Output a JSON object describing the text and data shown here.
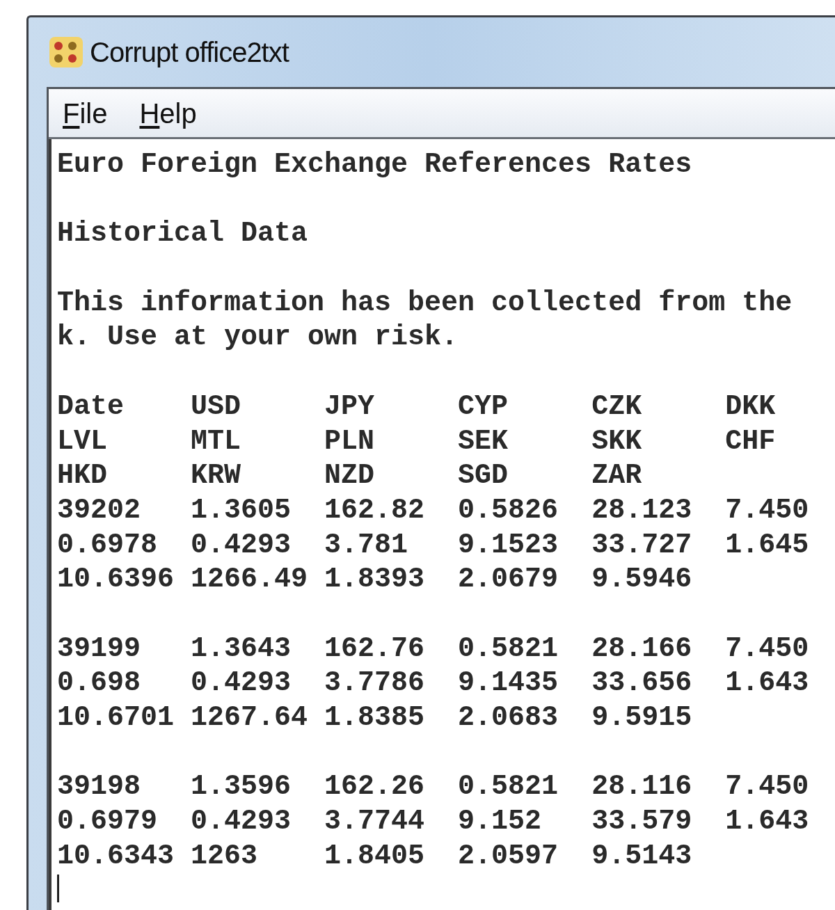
{
  "window": {
    "title": "Corrupt office2txt"
  },
  "menu": [
    {
      "label": "File",
      "underlined_first": true
    },
    {
      "label": "Help",
      "underlined_first": true
    }
  ],
  "document": {
    "blocks": [
      [
        "Euro Foreign Exchange References Rates"
      ],
      [
        "Historical Data"
      ],
      [
        "This information has been collected from the",
        "k. Use at your own risk."
      ],
      [
        "Date    USD     JPY     CYP     CZK     DKK",
        "LVL     MTL     PLN     SEK     SKK     CHF",
        "HKD     KRW     NZD     SGD     ZAR",
        "39202   1.3605  162.82  0.5826  28.123  7.450",
        "0.6978  0.4293  3.781   9.1523  33.727  1.645",
        "10.6396 1266.49 1.8393  2.0679  9.5946"
      ],
      [
        "39199   1.3643  162.76  0.5821  28.166  7.450",
        "0.698   0.4293  3.7786  9.1435  33.656  1.643",
        "10.6701 1267.64 1.8385  2.0683  9.5915"
      ],
      [
        "39198   1.3596  162.26  0.5821  28.116  7.450",
        "0.6979  0.4293  3.7744  9.152   33.579  1.643",
        "10.6343 1263    1.8405  2.0597  9.5143"
      ]
    ],
    "cursor_visible": true
  }
}
